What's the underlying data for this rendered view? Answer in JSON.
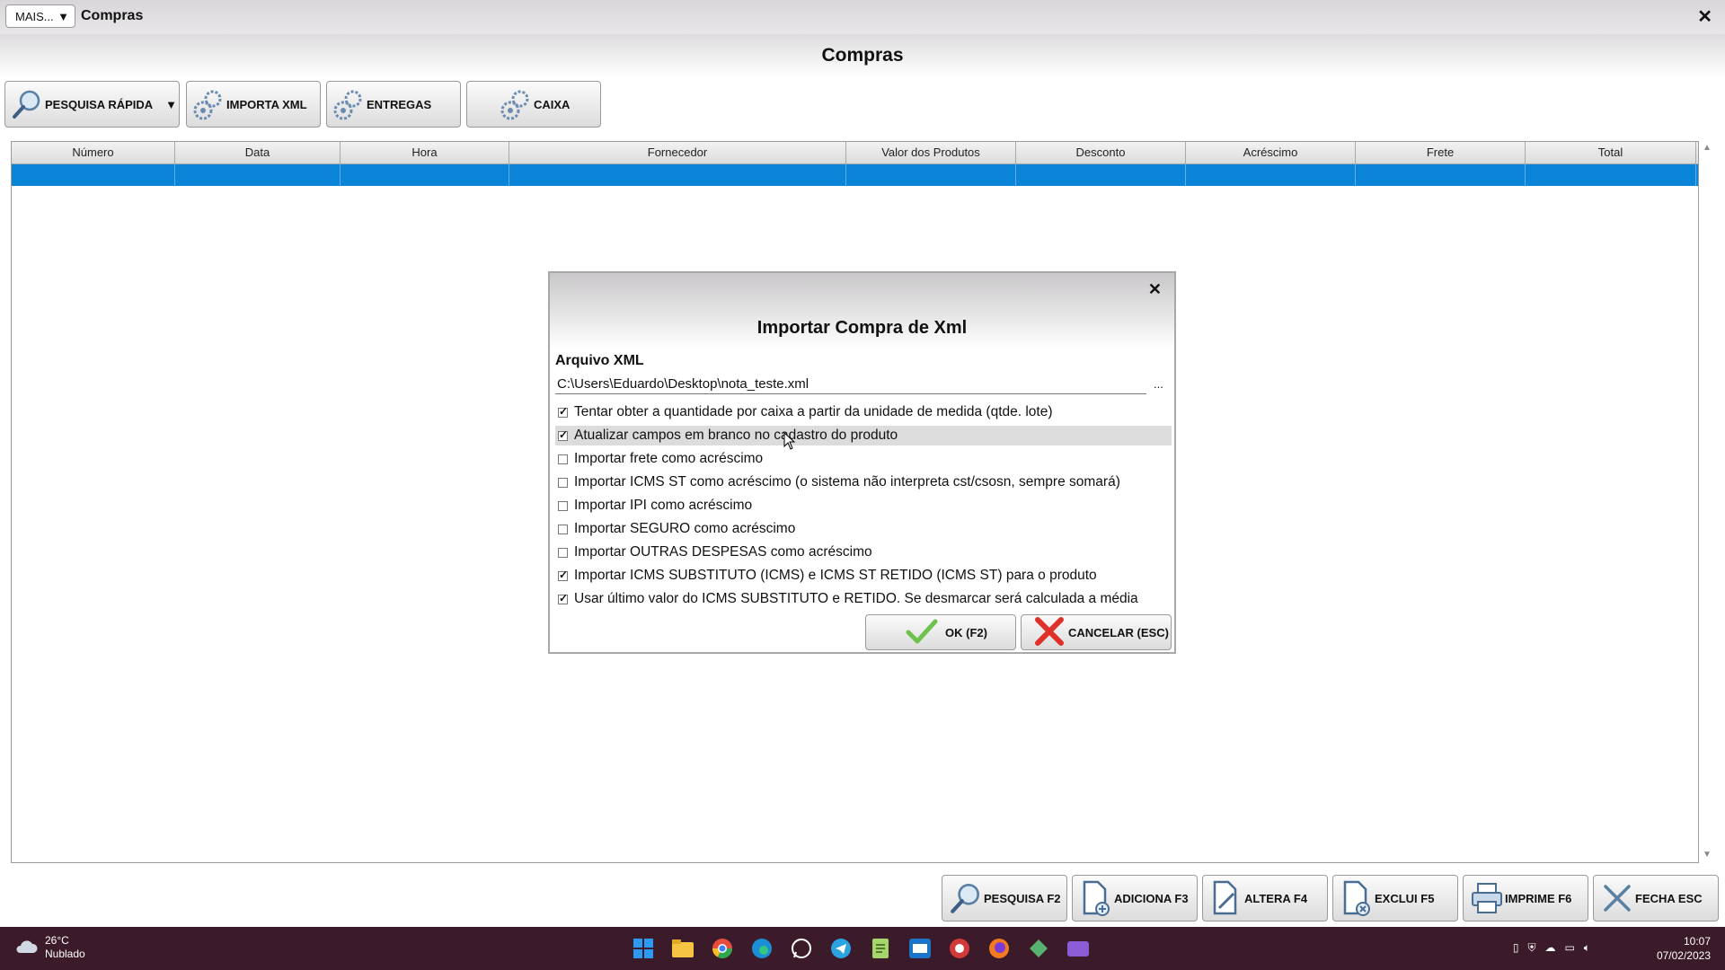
{
  "window": {
    "menu_button": "MAIS...",
    "title": "Compras",
    "close": "✕"
  },
  "header": {
    "title": "Compras"
  },
  "toolbar": {
    "quick_search": "PESQUISA RÁPIDA",
    "import_xml": "IMPORTA XML",
    "deliveries": "ENTREGAS",
    "cashier": "CAIXA"
  },
  "grid": {
    "columns": [
      "Número",
      "Data",
      "Hora",
      "Fornecedor",
      "Valor dos Produtos",
      "Desconto",
      "Acréscimo",
      "Frete",
      "Total"
    ]
  },
  "dialog": {
    "title": "Importar Compra de Xml",
    "close": "✕",
    "file_label": "Arquivo XML",
    "file_path": "C:\\Users\\Eduardo\\Desktop\\nota_teste.xml",
    "browse": "...",
    "options": [
      {
        "label": "Tentar obter a quantidade por caixa a partir da unidade de medida (qtde. lote)",
        "checked": true
      },
      {
        "label": "Atualizar campos em branco no cadastro do produto",
        "checked": true
      },
      {
        "label": "Importar frete como acréscimo",
        "checked": false
      },
      {
        "label": "Importar ICMS ST como acréscimo (o sistema não interpreta cst/csosn, sempre somará)",
        "checked": false
      },
      {
        "label": "Importar IPI como acréscimo",
        "checked": false
      },
      {
        "label": "Importar SEGURO como acréscimo",
        "checked": false
      },
      {
        "label": "Importar OUTRAS DESPESAS como acréscimo",
        "checked": false
      },
      {
        "label": "Importar ICMS SUBSTITUTO (ICMS) e ICMS ST RETIDO (ICMS ST) para o produto",
        "checked": true
      },
      {
        "label": "Usar último valor do ICMS SUBSTITUTO e RETIDO. Se desmarcar será calculada a média",
        "checked": true
      }
    ],
    "ok": "OK (F2)",
    "cancel": "CANCELAR (ESC)"
  },
  "bottom_bar": {
    "search": "PESQUISA F2",
    "add": "ADICIONA F3",
    "edit": "ALTERA F4",
    "delete": "EXCLUI F5",
    "print": "IMPRIME F6",
    "close": "FECHA ESC"
  },
  "taskbar": {
    "temperature": "26°C",
    "weather": "Nublado",
    "time": "10:07",
    "date": "07/02/2023",
    "apps": [
      "start-icon",
      "file-explorer-icon",
      "chrome-icon",
      "edge-icon",
      "whatsapp-icon",
      "telegram-icon",
      "notepad-icon",
      "outlook-icon",
      "app-icon",
      "firefox-icon",
      "system-app-icon",
      "video-app-icon"
    ]
  }
}
